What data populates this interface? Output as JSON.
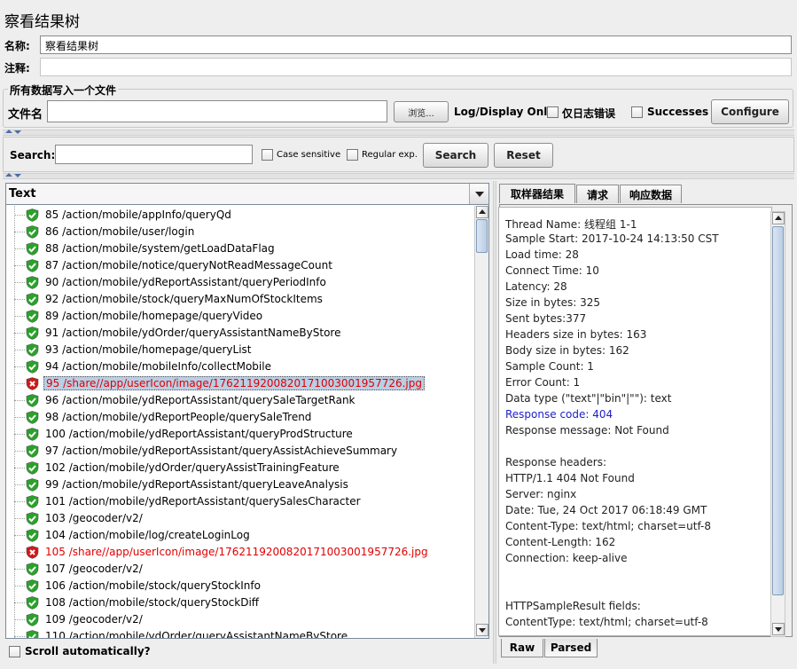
{
  "title": "察看结果树",
  "name_label": "名称:",
  "name_value": "察看结果树",
  "comment_label": "注释:",
  "file_group_label": "所有数据写入一个文件",
  "filename_label": "文件名",
  "browse_label": "浏览...",
  "log_display_label": "Log/Display Only:",
  "errors_only_label": "仅日志错误",
  "successes_label": "Successes",
  "configure_label": "Configure",
  "search": {
    "label": "Search:",
    "case_sensitive_label": "Case sensitive",
    "regex_label": "Regular exp.",
    "search_button": "Search",
    "reset_button": "Reset"
  },
  "tree": {
    "header": "Text",
    "rows": [
      {
        "text": "85 /action/mobile/appInfo/queryQd",
        "status": "ok"
      },
      {
        "text": "86 /action/mobile/user/login",
        "status": "ok"
      },
      {
        "text": "88 /action/mobile/system/getLoadDataFlag",
        "status": "ok"
      },
      {
        "text": "87 /action/mobile/notice/queryNotReadMessageCount",
        "status": "ok"
      },
      {
        "text": "90 /action/mobile/ydReportAssistant/queryPeriodInfo",
        "status": "ok"
      },
      {
        "text": "92 /action/mobile/stock/queryMaxNumOfStockItems",
        "status": "ok"
      },
      {
        "text": "89 /action/mobile/homepage/queryVideo",
        "status": "ok"
      },
      {
        "text": "91 /action/mobile/ydOrder/queryAssistantNameByStore",
        "status": "ok"
      },
      {
        "text": "93 /action/mobile/homepage/queryList",
        "status": "ok"
      },
      {
        "text": "94 /action/mobile/mobileInfo/collectMobile",
        "status": "ok"
      },
      {
        "text": "95 /share//app/userIcon/image/17621192008201710030019577​26.jpg",
        "status": "error",
        "selected": true
      },
      {
        "text": "96 /action/mobile/ydReportAssistant/querySaleTargetRank",
        "status": "ok"
      },
      {
        "text": "98 /action/mobile/ydReportPeople/querySaleTrend",
        "status": "ok"
      },
      {
        "text": "100 /action/mobile/ydReportAssistant/queryProdStructure",
        "status": "ok"
      },
      {
        "text": "97 /action/mobile/ydReportAssistant/queryAssistAchieveSummary",
        "status": "ok"
      },
      {
        "text": "102 /action/mobile/ydOrder/queryAssistTrainingFeature",
        "status": "ok"
      },
      {
        "text": "99 /action/mobile/ydReportAssistant/queryLeaveAnalysis",
        "status": "ok"
      },
      {
        "text": "101 /action/mobile/ydReportAssistant/querySalesCharacter",
        "status": "ok"
      },
      {
        "text": "103 /geocoder/v2/",
        "status": "ok"
      },
      {
        "text": "104 /action/mobile/log/createLoginLog",
        "status": "ok"
      },
      {
        "text": "105 /share//app/userIcon/image/1762119200820171003001957726.jpg",
        "status": "error"
      },
      {
        "text": "107 /geocoder/v2/",
        "status": "ok"
      },
      {
        "text": "106 /action/mobile/stock/queryStockInfo",
        "status": "ok"
      },
      {
        "text": "108 /action/mobile/stock/queryStockDiff",
        "status": "ok"
      },
      {
        "text": "109 /geocoder/v2/",
        "status": "ok"
      },
      {
        "text": "110 /action/mobile/ydOrder/queryAssistantNameByStore",
        "status": "ok"
      }
    ]
  },
  "scroll_auto_label": "Scroll automatically?",
  "tabs": [
    "取样器结果",
    "请求",
    "响应数据"
  ],
  "bottom_tabs": [
    "Raw",
    "Parsed"
  ],
  "result_lines": [
    "Thread Name: 线程组 1-1",
    "Sample Start: 2017-10-24 14:13:50 CST",
    "Load time: 28",
    "Connect Time: 10",
    "Latency: 28",
    "Size in bytes: 325",
    "Sent bytes:377",
    "Headers size in bytes: 163",
    "Body size in bytes: 162",
    "Sample Count: 1",
    "Error Count: 1",
    "Data type (\"text\"|\"bin\"|\"\"): text",
    "Response code: 404",
    "Response message: Not Found",
    "",
    "Response headers:",
    "HTTP/1.1 404 Not Found",
    "Server: nginx",
    "Date: Tue, 24 Oct 2017 06:18:49 GMT",
    "Content-Type: text/html; charset=utf-8",
    "Content-Length: 162",
    "Connection: keep-alive",
    "",
    "",
    "HTTPSampleResult fields:",
    "ContentType: text/html; charset=utf-8"
  ],
  "colors": {
    "ok": "#2aa22a",
    "error": "#d01818",
    "response_code": "#1d1dcc",
    "selection": "#b8cfe5"
  }
}
